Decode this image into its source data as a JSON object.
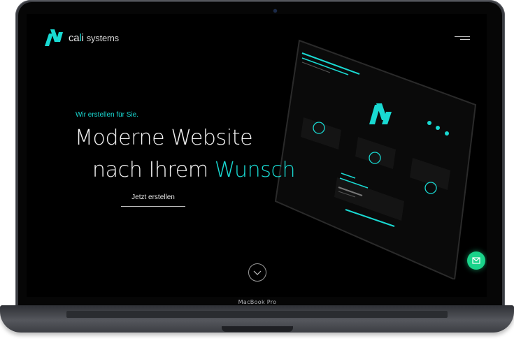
{
  "device": {
    "model_label": "MacBook Pro"
  },
  "nav": {
    "logo_brand": "ca",
    "logo_dot": "l",
    "logo_suffix": "i",
    "logo_rest": "systems",
    "menu_icon": "hamburger-icon"
  },
  "hero": {
    "eyebrow": "Wir erstellen für Sie.",
    "title_line1": "Moderne Website",
    "title_line2_prefix": "nach Ihrem ",
    "title_line2_accent": "Wunsch",
    "cta_label": "Jetzt erstellen"
  },
  "scroll": {
    "icon": "chevron-down-icon"
  },
  "contact": {
    "icon": "mail-icon"
  },
  "colors": {
    "accent": "#19d9d2",
    "background": "#000000",
    "contact": "#1ad38a"
  }
}
